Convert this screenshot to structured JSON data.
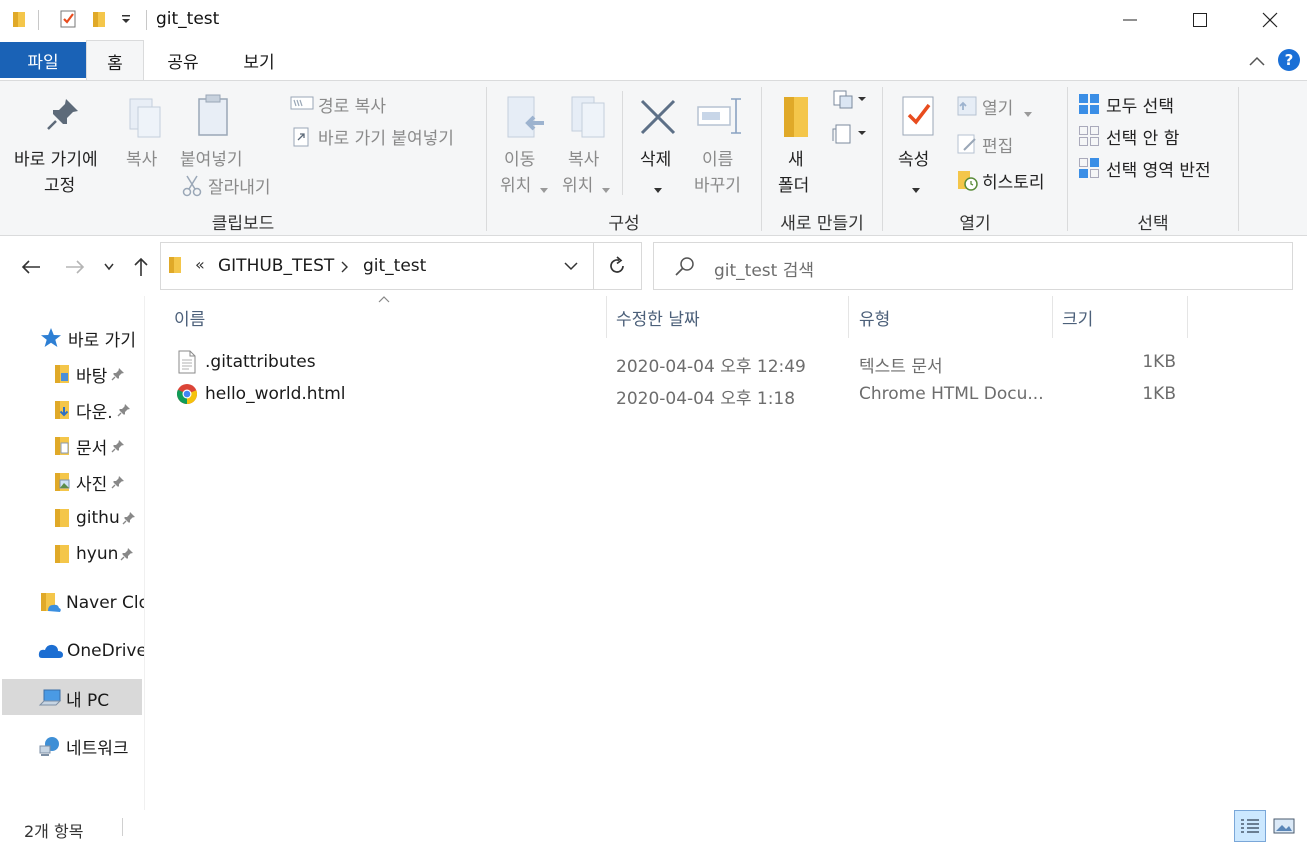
{
  "window": {
    "title": "git_test",
    "controls": {
      "minimize": "minimize",
      "maximize": "maximize",
      "close": "close"
    }
  },
  "tabs": [
    {
      "label": "파일"
    },
    {
      "label": "홈"
    },
    {
      "label": "공유"
    },
    {
      "label": "보기"
    }
  ],
  "ribbon": {
    "clipboard": {
      "pin_label_1": "바로 가기에",
      "pin_label_2": "고정",
      "copy": "복사",
      "paste": "붙여넣기",
      "copy_path": "경로 복사",
      "paste_shortcut": "바로 가기 붙여넣기",
      "cut": "잘라내기",
      "group": "클립보드"
    },
    "organize": {
      "move_1": "이동",
      "move_2": "위치",
      "copy_1": "복사",
      "copy_2": "위치",
      "delete": "삭제",
      "rename_1": "이름",
      "rename_2": "바꾸기",
      "group": "구성"
    },
    "new": {
      "folder_1": "새",
      "folder_2": "폴더",
      "group": "새로 만들기"
    },
    "open": {
      "properties": "속성",
      "open": "열기",
      "edit": "편집",
      "history": "히스토리",
      "group": "열기"
    },
    "select": {
      "all": "모두 선택",
      "none": "선택 안 함",
      "invert": "선택 영역 반전",
      "group": "선택"
    }
  },
  "address": {
    "overflow": "«",
    "crumbs": [
      "GITHUB_TEST",
      "git_test"
    ],
    "search_placeholder": "git_test 검색"
  },
  "nav": {
    "quick_access": "바로 가기",
    "items": [
      "바탕",
      "다운.",
      "문서",
      "사진",
      "githu",
      "hyun"
    ],
    "naver": "Naver Clo",
    "onedrive": "OneDrive",
    "mypc": "내 PC",
    "network": "네트워크"
  },
  "columns": {
    "name": "이름",
    "date": "수정한 날짜",
    "type": "유형",
    "size": "크기"
  },
  "files": [
    {
      "name": ".gitattributes",
      "date": "2020-04-04 오후 12:49",
      "type": "텍스트 문서",
      "size": "1KB"
    },
    {
      "name": "hello_world.html",
      "date": "2020-04-04 오후 1:18",
      "type": "Chrome HTML Docu...",
      "size": "1KB"
    }
  ],
  "status": {
    "count": "2개 항목"
  },
  "colors": {
    "accent": "#1a62b6",
    "folder": "#f0c04a",
    "selection": "#cce8ff"
  }
}
